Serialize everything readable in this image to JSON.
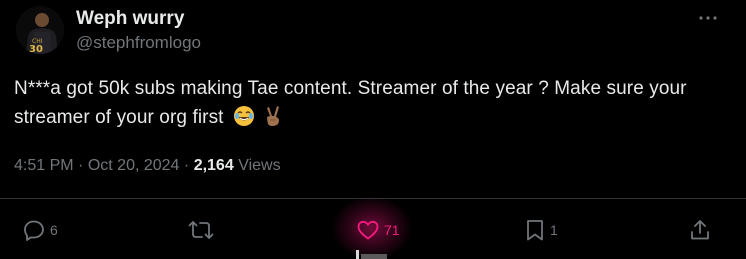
{
  "author": {
    "name": "Weph wurry",
    "handle": "@stephfromlogo",
    "avatar_jersey_number": "30"
  },
  "post": {
    "text": "N***a got 50k subs making Tae content. Streamer of the year ? Make sure your streamer of your org first",
    "emojis": [
      "face-with-tears-of-joy",
      "victory-hand-medium-dark-skin"
    ]
  },
  "meta": {
    "time": "4:51 PM",
    "date": "Oct 20, 2024",
    "separator": "·",
    "views_count": "2,164",
    "views_label": "Views"
  },
  "actions": {
    "reply_count": "6",
    "retweet_count": "",
    "like_count": "71",
    "bookmark_count": "1"
  },
  "colors": {
    "background": "#000000",
    "primary_text": "#e7e9ea",
    "secondary_text": "#71767b",
    "divider": "#2f3336",
    "like_accent": "#f91880"
  },
  "icons": {
    "more": "more-dots-icon",
    "reply": "reply-icon",
    "retweet": "retweet-icon",
    "like": "heart-icon",
    "bookmark": "bookmark-icon",
    "share": "share-icon"
  }
}
